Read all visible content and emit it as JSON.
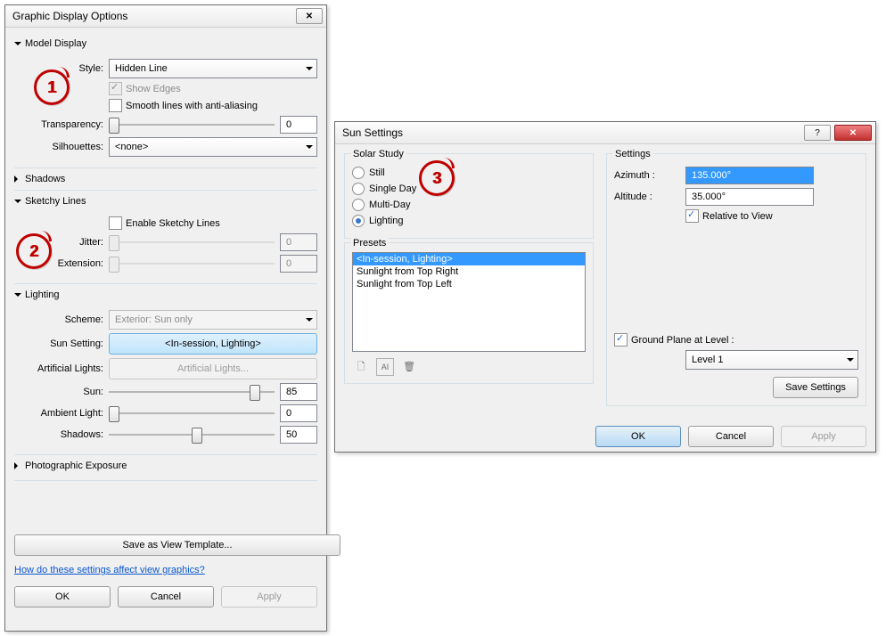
{
  "dlg1": {
    "title": "Graphic Display Options",
    "model_display": {
      "header": "Model Display",
      "style_label": "Style:",
      "style_value": "Hidden Line",
      "show_edges": "Show Edges",
      "smooth_lines": "Smooth lines with anti-aliasing",
      "transparency_label": "Transparency:",
      "transparency_value": "0",
      "silhouettes_label": "Silhouettes:",
      "silhouettes_value": "<none>"
    },
    "shadows": {
      "header": "Shadows"
    },
    "sketchy": {
      "header": "Sketchy Lines",
      "enable": "Enable Sketchy Lines",
      "jitter_label": "Jitter:",
      "jitter_value": "0",
      "extension_label": "Extension:",
      "extension_value": "0"
    },
    "lighting": {
      "header": "Lighting",
      "scheme_label": "Scheme:",
      "scheme_value": "Exterior: Sun only",
      "sun_setting_label": "Sun Setting:",
      "sun_setting_value": "<In-session, Lighting>",
      "art_label": "Artificial Lights:",
      "art_value": "Artificial Lights...",
      "sun_label": "Sun:",
      "sun_value": "85",
      "ambient_label": "Ambient Light:",
      "ambient_value": "0",
      "shadows_label": "Shadows:",
      "shadows_value": "50"
    },
    "photo": {
      "header": "Photographic Exposure"
    },
    "save_template": "Save as View Template...",
    "help_link": "How do these settings affect view graphics?",
    "ok": "OK",
    "cancel": "Cancel",
    "apply": "Apply"
  },
  "dlg2": {
    "title": "Sun Settings",
    "solar_study": {
      "legend": "Solar Study",
      "still": "Still",
      "single": "Single Day",
      "multi": "Multi-Day",
      "lighting": "Lighting"
    },
    "presets": {
      "legend": "Presets",
      "items": [
        "<In-session, Lighting>",
        "Sunlight from Top Right",
        "Sunlight from Top Left"
      ]
    },
    "settings": {
      "legend": "Settings",
      "azimuth_label": "Azimuth :",
      "azimuth_value": "135.000°",
      "altitude_label": "Altitude :",
      "altitude_value": "35.000°",
      "relative": "Relative to View",
      "ground_plane": "Ground Plane at Level :",
      "level_value": "Level 1",
      "save": "Save Settings"
    },
    "ok": "OK",
    "cancel": "Cancel",
    "apply": "Apply",
    "help": "?"
  },
  "markers": {
    "1": "1",
    "2": "2",
    "3": "3"
  }
}
